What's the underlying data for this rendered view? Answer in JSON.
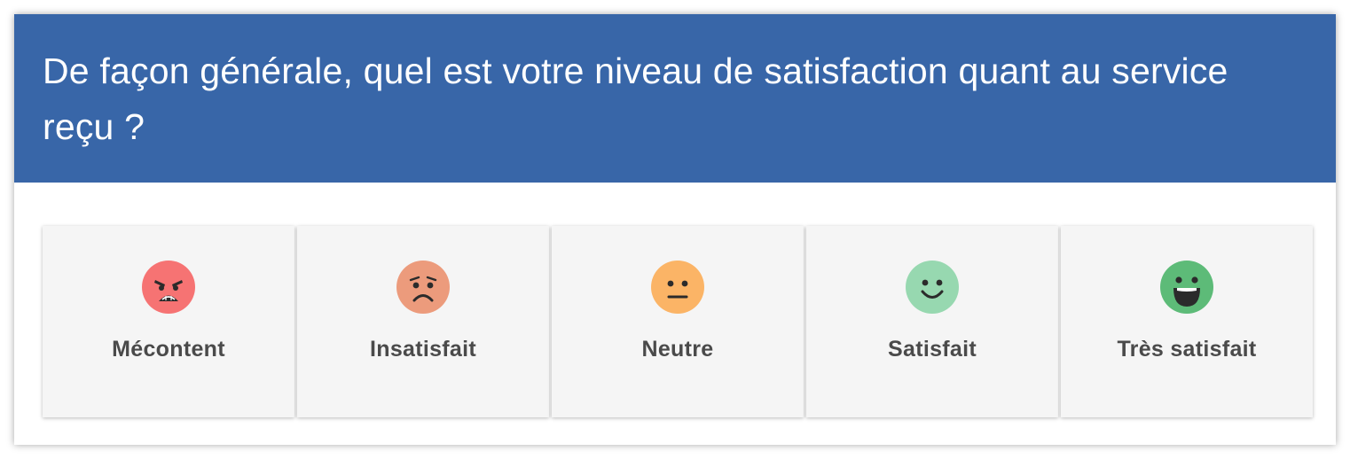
{
  "question": {
    "text": "De façon générale, quel est votre niveau de satisfaction quant au service reçu ?"
  },
  "colors": {
    "header_bg": "#3866a8",
    "header_text": "#ffffff",
    "option_bg": "#f5f5f5",
    "label_text": "#4a4a4a"
  },
  "options": [
    {
      "label": "Mécontent",
      "icon": "angry-face-icon",
      "color": "#f67373"
    },
    {
      "label": "Insatisfait",
      "icon": "sad-face-icon",
      "color": "#ec9b7c"
    },
    {
      "label": "Neutre",
      "icon": "neutral-face-icon",
      "color": "#fbb466"
    },
    {
      "label": "Satisfait",
      "icon": "smile-face-icon",
      "color": "#97d8b0"
    },
    {
      "label": "Très satisfait",
      "icon": "big-smile-face-icon",
      "color": "#5dbb78"
    }
  ]
}
